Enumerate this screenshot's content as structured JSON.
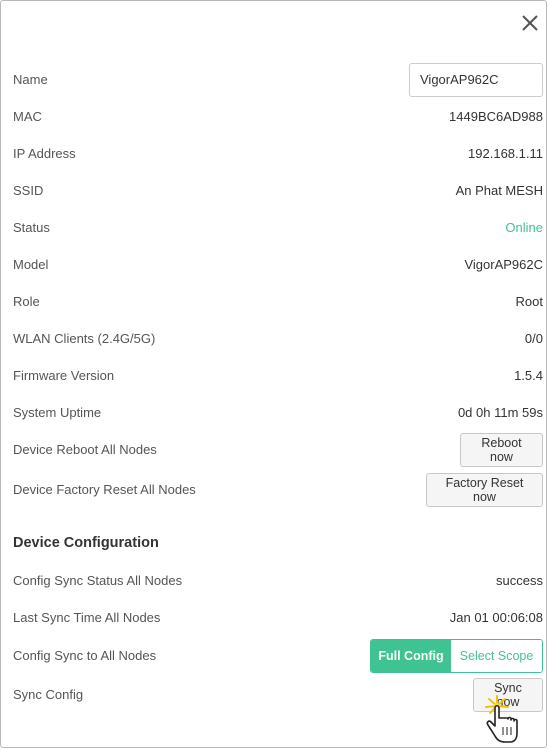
{
  "fields": {
    "name": {
      "label": "Name",
      "value": "VigorAP962C"
    },
    "mac": {
      "label": "MAC",
      "value": "1449BC6AD988"
    },
    "ip": {
      "label": "IP Address",
      "value": "192.168.1.11"
    },
    "ssid": {
      "label": "SSID",
      "value": "An Phat MESH"
    },
    "status": {
      "label": "Status",
      "value": "Online"
    },
    "model": {
      "label": "Model",
      "value": "VigorAP962C"
    },
    "role": {
      "label": "Role",
      "value": "Root"
    },
    "wlan": {
      "label": "WLAN Clients (2.4G/5G)",
      "value": "0/0"
    },
    "firmware": {
      "label": "Firmware Version",
      "value": "1.5.4"
    },
    "uptime": {
      "label": "System Uptime",
      "value": "0d 0h 11m 59s"
    },
    "reboot": {
      "label": "Device Reboot All Nodes",
      "button": "Reboot now"
    },
    "factory": {
      "label": "Device Factory Reset All Nodes",
      "button": "Factory Reset now"
    }
  },
  "config": {
    "title": "Device Configuration",
    "sync_status": {
      "label": "Config Sync Status All Nodes",
      "value": "success"
    },
    "last_sync": {
      "label": "Last Sync Time All Nodes",
      "value": "Jan 01 00:06:08"
    },
    "sync_to": {
      "label": "Config Sync to All Nodes",
      "options": [
        "Full Config",
        "Select Scope"
      ],
      "selected": "Full Config"
    },
    "sync_config": {
      "label": "Sync Config",
      "button": "Sync now"
    }
  },
  "colors": {
    "accent": "#3fc393",
    "status_online": "#3fc393"
  },
  "icons": {
    "close": "close-icon",
    "cursor": "hand-pointer-cursor"
  }
}
